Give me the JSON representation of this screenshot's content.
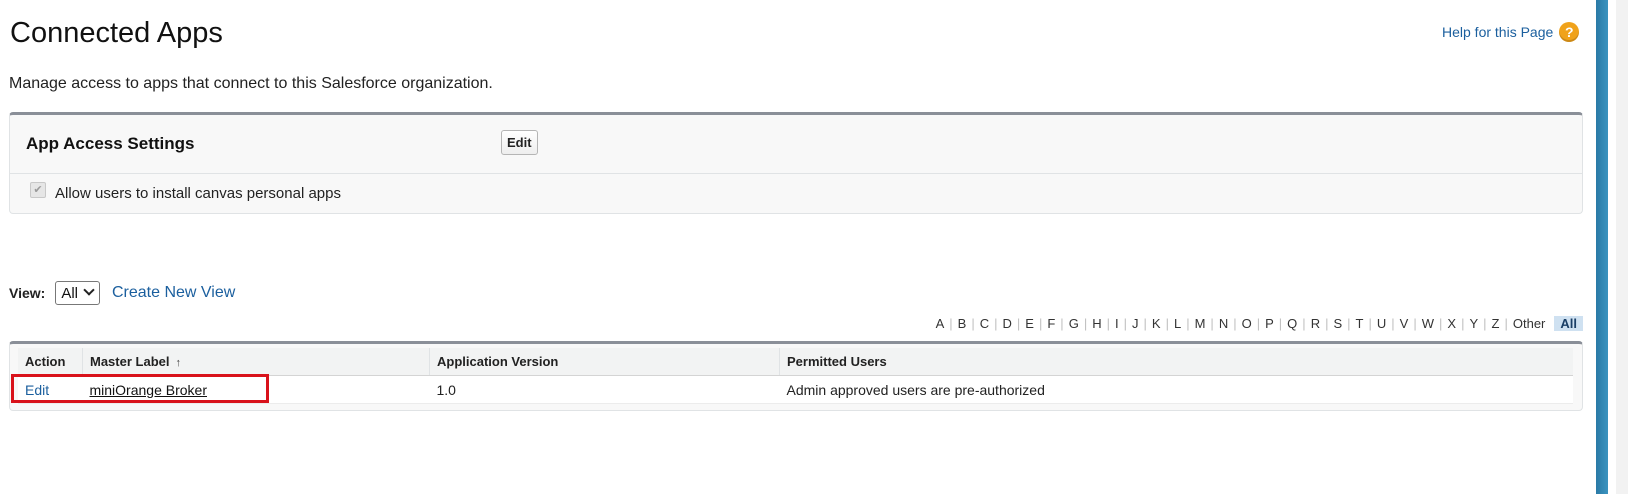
{
  "page": {
    "title": "Connected Apps",
    "description": "Manage access to apps that connect to this Salesforce organization.",
    "help_link": "Help for this Page",
    "help_icon": "?"
  },
  "settings": {
    "title": "App Access Settings",
    "edit_label": "Edit",
    "checkbox_label": "Allow users to install canvas personal apps",
    "checkbox_checked": true
  },
  "view": {
    "label": "View:",
    "selected": "All",
    "create_link": "Create New View"
  },
  "alpha_filter": [
    "A",
    "B",
    "C",
    "D",
    "E",
    "F",
    "G",
    "H",
    "I",
    "J",
    "K",
    "L",
    "M",
    "N",
    "O",
    "P",
    "Q",
    "R",
    "S",
    "T",
    "U",
    "V",
    "W",
    "X",
    "Y",
    "Z",
    "Other",
    "All"
  ],
  "alpha_active": "All",
  "table": {
    "columns": [
      "Action",
      "Master Label",
      "Application Version",
      "Permitted Users"
    ],
    "sort_indicator": "↑",
    "rows": [
      {
        "action": "Edit",
        "master_label": "miniOrange Broker",
        "version": "1.0",
        "permitted_users": "Admin approved users are pre-authorized"
      }
    ]
  },
  "colors": {
    "link": "#1b5f9e",
    "highlight": "#d9121b",
    "help_icon": "#f0a21a",
    "box_border_top": "#8a8f98",
    "scroll_thumb": "#2a7aa6"
  }
}
